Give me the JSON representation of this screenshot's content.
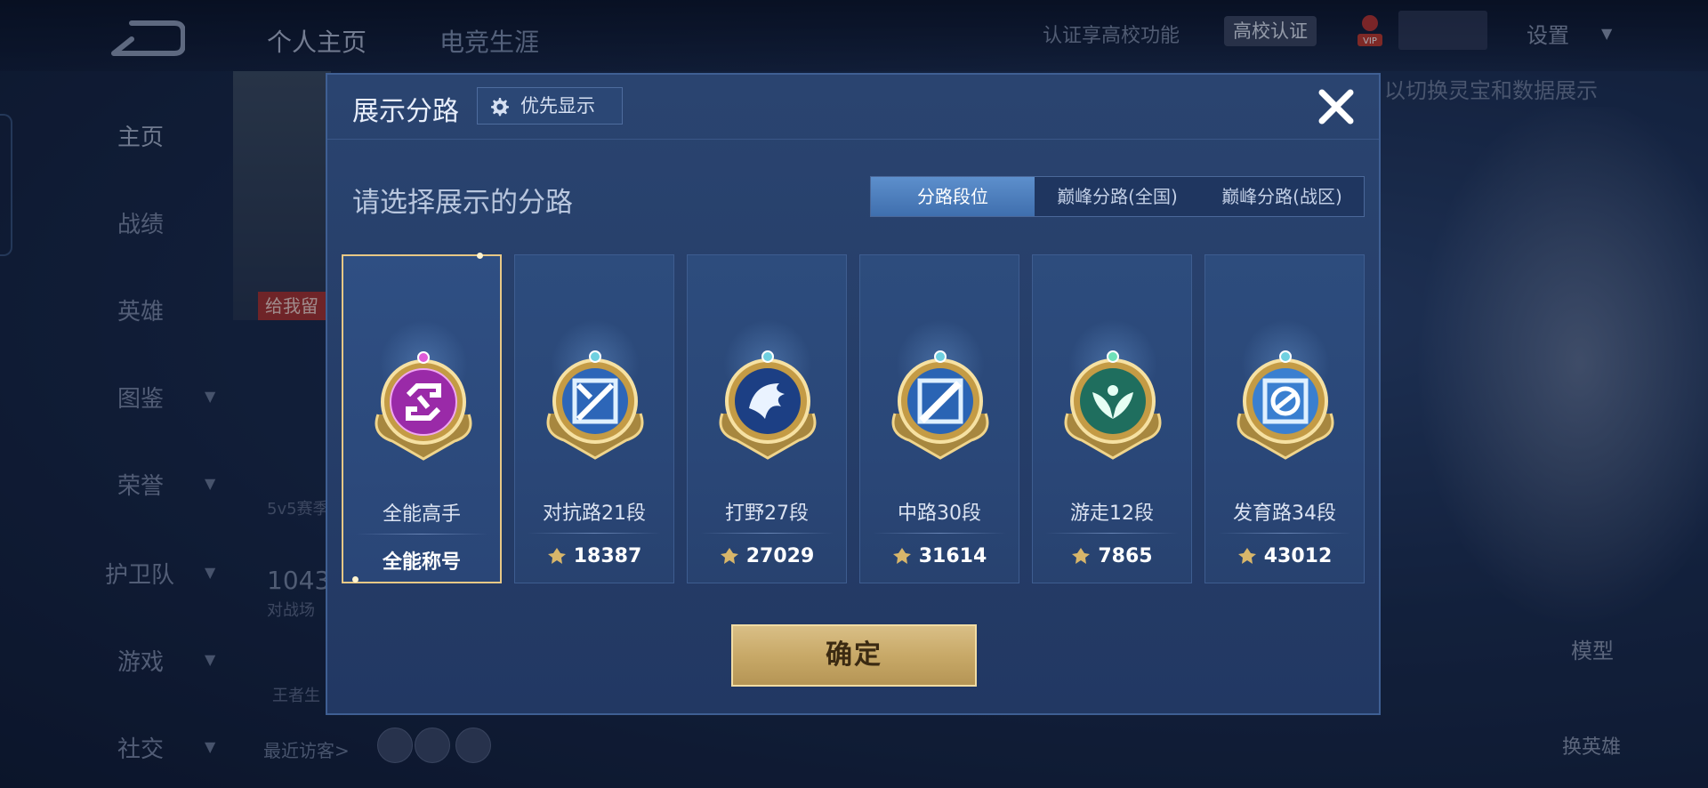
{
  "background": {
    "top_tabs": [
      "个人主页",
      "电竞生涯"
    ],
    "certify_text": "认证享高校功能",
    "certify_badge": "高校认证",
    "settings_label": "设置",
    "hint_text": "以切换灵宝和数据展示",
    "sidebar_items": [
      "主页",
      "战绩",
      "英雄",
      "图鉴",
      "荣誉",
      "护卫队",
      "游戏",
      "社交"
    ],
    "like_tag": "给我留",
    "mode_text": "5v5赛季",
    "stat_number": "1043",
    "stat_label": "对战场",
    "king_text": "王者生",
    "recent_visitors": "最近访客>",
    "model_label": "模型",
    "switch_hero_label": "换英雄"
  },
  "modal": {
    "title": "展示分路",
    "priority_button": "优先显示",
    "prompt": "请选择展示的分路",
    "tabs": [
      "分路段位",
      "巅峰分路(全国)",
      "巅峰分路(战区)"
    ],
    "active_tab": "分路段位",
    "cards": [
      {
        "role": "全能高手",
        "bottom": "全能称号",
        "emblem": "all-round-emblem-icon",
        "selected": true
      },
      {
        "role": "对抗路21段",
        "points": "18387",
        "emblem": "clash-lane-emblem-icon"
      },
      {
        "role": "打野27段",
        "points": "27029",
        "emblem": "jungle-emblem-icon"
      },
      {
        "role": "中路30段",
        "points": "31614",
        "emblem": "mid-lane-emblem-icon"
      },
      {
        "role": "游走12段",
        "points": "7865",
        "emblem": "roam-emblem-icon"
      },
      {
        "role": "发育路34段",
        "points": "43012",
        "emblem": "farm-lane-emblem-icon"
      }
    ],
    "confirm_button": "确定"
  },
  "colors": {
    "gold_accent": "#e8c886",
    "active_tab": "#4f82c2",
    "modal_bg": "#263e69"
  }
}
